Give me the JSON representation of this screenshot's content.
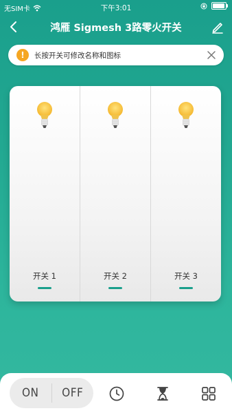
{
  "status_bar": {
    "carrier": "无SIM卡",
    "time": "下午3:01"
  },
  "nav": {
    "title": "鸿雁 Sigmesh 3路零火开关"
  },
  "notice": {
    "icon": "exclamation-icon",
    "text": "长按开关可修改名称和图标"
  },
  "switches": [
    {
      "label": "开关 1",
      "state": "on"
    },
    {
      "label": "开关 2",
      "state": "on"
    },
    {
      "label": "开关 3",
      "state": "on"
    }
  ],
  "bottom_bar": {
    "on_label": "ON",
    "off_label": "OFF",
    "tools": [
      "clock-icon",
      "hourglass-icon",
      "grid-icon"
    ]
  },
  "colors": {
    "accent": "#1a9f8c",
    "bulb": "#ffc94a",
    "warning": "#f5a623"
  }
}
